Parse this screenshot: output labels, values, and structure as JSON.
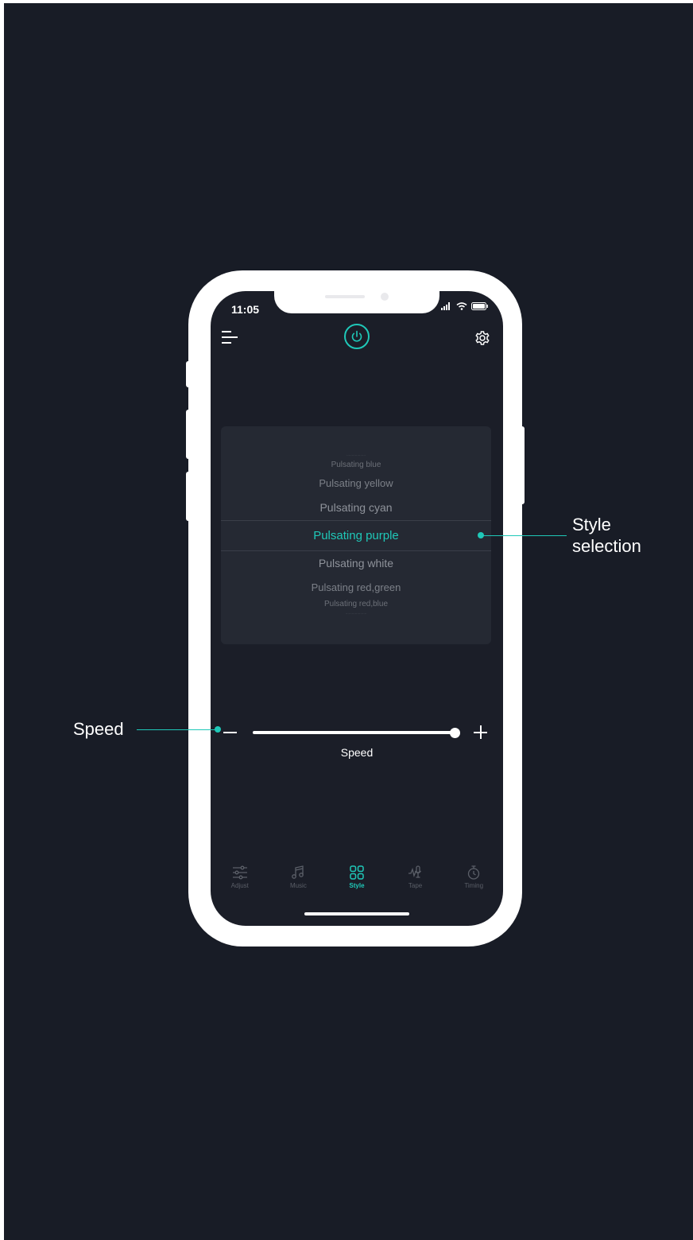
{
  "colors": {
    "accent": "#1fc8b8",
    "background": "#181c26",
    "screen": "#1b1e28",
    "picker": "#252933"
  },
  "status_bar": {
    "time": "11:05"
  },
  "header": {
    "menu_icon": "menu-icon",
    "power_icon": "power-icon",
    "settings_icon": "gear-icon"
  },
  "style_picker": {
    "items": [
      "Pulsating blue",
      "Pulsating yellow",
      "Pulsating cyan",
      "Pulsating purple",
      "Pulsating white",
      "Pulsating red,green",
      "Pulsating red,blue"
    ],
    "selected": "Pulsating purple"
  },
  "speed": {
    "label": "Speed",
    "value_fraction": 1.0
  },
  "tabs": [
    {
      "label": "Adjust",
      "icon": "sliders-icon"
    },
    {
      "label": "Music",
      "icon": "music-icon"
    },
    {
      "label": "Style",
      "icon": "grid-icon",
      "active": true
    },
    {
      "label": "Tape",
      "icon": "tape-icon"
    },
    {
      "label": "Timing",
      "icon": "timer-icon"
    }
  ],
  "annotations": {
    "style": "Style\nselection",
    "speed": "Speed"
  }
}
